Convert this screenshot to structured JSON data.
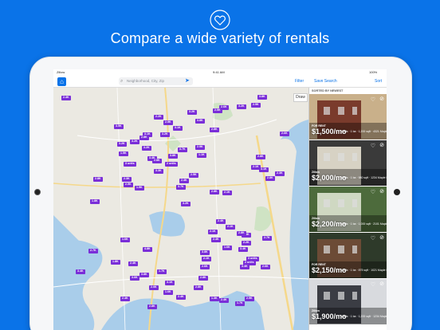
{
  "headline": "Compare a wide variety of rentals",
  "statusbar": {
    "carrier": "Zillow",
    "time": "9:41 AM",
    "battery": "100%"
  },
  "toolbar": {
    "search_placeholder": "Neighborhood, City, Zip",
    "filter": "Filter",
    "save_search": "Save Search",
    "sort": "Sort"
  },
  "map": {
    "draw": "Draw",
    "pins": [
      "3.8K",
      "2.9K",
      "3.2K",
      "2.6K",
      "2.5K",
      "3.2K",
      "2.2K",
      "3.8K",
      "2.5K",
      "3.5K",
      "3.1K",
      "2.8K",
      "2.6K",
      "3.2K",
      "3.1K",
      "2.8K",
      "3.2K",
      "3.2K",
      "3.2K",
      "2.9K",
      "3.7K",
      "1.5K",
      "3.8K",
      "1.1K",
      "2.8K",
      "3.4K",
      "2.8K",
      "2 units",
      "3 units",
      "2.1K",
      "3.1K",
      "2.3K",
      "3.3K",
      "2.5K",
      "2.8K",
      "2.4K",
      "2.8K",
      "2.3K",
      "3.7K",
      "1.9K",
      "2.1K",
      "2.8K",
      "2.5K",
      "1.8K",
      "3.2K",
      "2.4K",
      "2.1K",
      "3.8K",
      "2.2K",
      "2.1K",
      "2.8K",
      "2.7K",
      "1.6K",
      "2.4K",
      "3.4K",
      "1.6K",
      "4.8K",
      "2.7K",
      "3.8K",
      "2.1K",
      "2.6K",
      "3 units",
      "2 units",
      "1.8K",
      "2.4K",
      "2.6K",
      "3.4K",
      "3.4K",
      "1.7K",
      "3.8K",
      "2.8K",
      "3.6K",
      "3.1K",
      "2.0K",
      "2.8K",
      "1.6K",
      "2.4K",
      "2.4K",
      "1.3K",
      "2.8K",
      "2.4K",
      "1.7K",
      "2.5K",
      "2.4K"
    ]
  },
  "list": {
    "sorted_by": "SORTED BY NEWEST",
    "cards": [
      {
        "tag": "FOR RENT",
        "price": "$1,500/mo",
        "details": "3 bds · 1 ba · 1,200 sqft · 4321 Maple Street, Seattle",
        "colors": [
          "#7a3b2c",
          "#c9b08a"
        ]
      },
      {
        "tag": "Zillow",
        "price": "$2,000/mo",
        "details": "1 bds · 1 ba · 980 sqft · 1234 Maple St, Seattle",
        "colors": [
          "#d7d2c4",
          "#3a3a3a"
        ]
      },
      {
        "tag": "Zillow",
        "price": "$2,200/mo",
        "details": "1 bds · 1 ba · 1,000 sqft · 2101 Maple St, Seattle",
        "colors": [
          "#cfd8c2",
          "#4d6b3c"
        ]
      },
      {
        "tag": "FOR RENT",
        "price": "$2,150/mo",
        "details": "1 bds · 1 ba · 875 sqft · 1021 Maple Street #304, Seattle",
        "colors": [
          "#6c4b36",
          "#2e3a2a"
        ]
      },
      {
        "tag": "Zillow",
        "price": "$1,900/mo",
        "details": "1 bds · 1 ba · 1,200 sqft · 1234 Maple St, Seattle",
        "colors": [
          "#3b3d44",
          "#d8dade"
        ]
      }
    ]
  },
  "colors": {
    "brand": "#0a73e8",
    "pin": "#7a2ed8",
    "water": "#a9cdea",
    "park": "#cfe3c4",
    "road": "#f5d88a"
  }
}
